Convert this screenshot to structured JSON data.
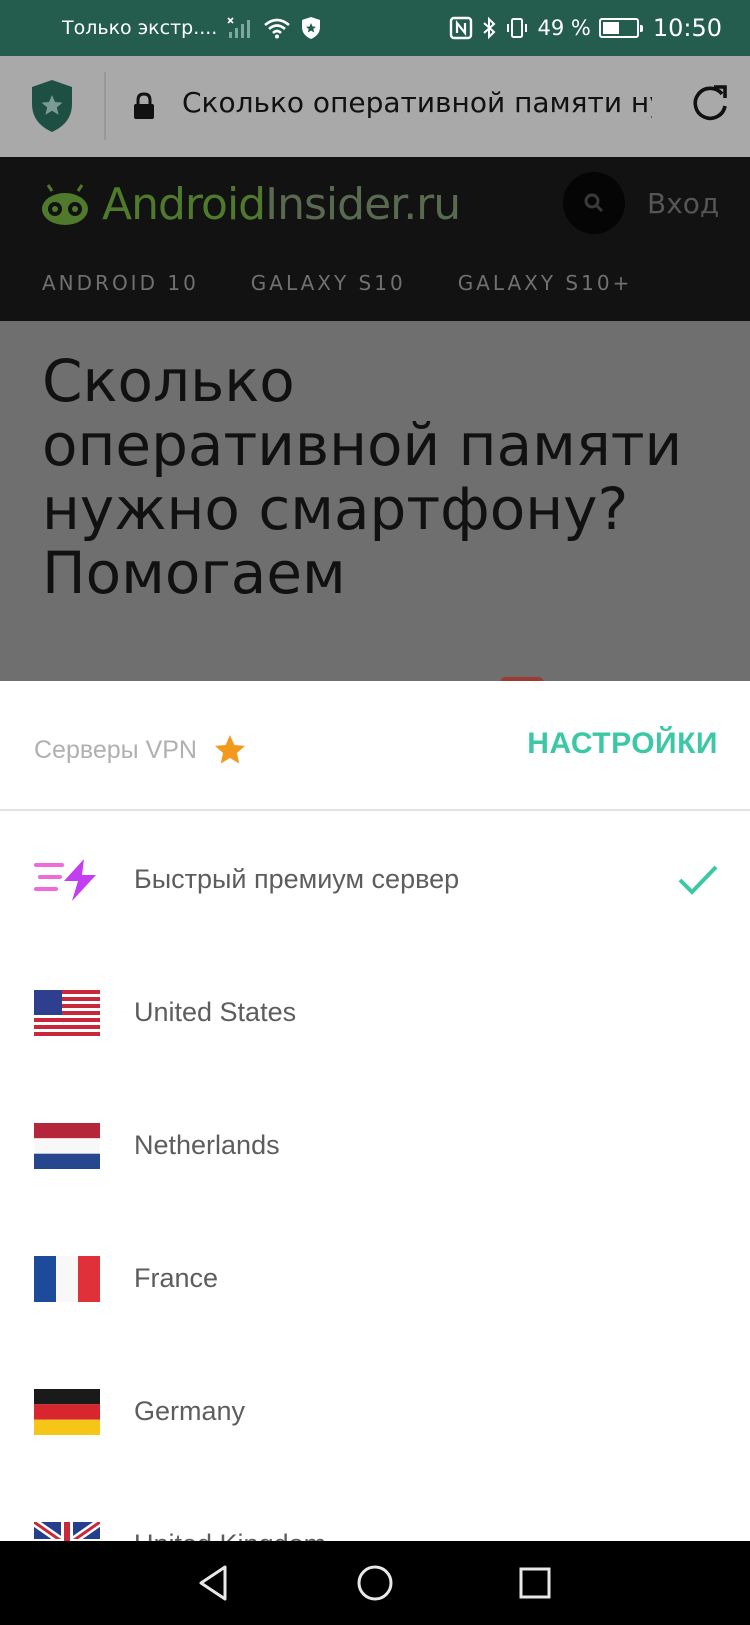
{
  "status_bar": {
    "carrier": "Только экстр....",
    "battery_percent": "49 %",
    "battery_level": 0.49,
    "time": "10:50"
  },
  "browser": {
    "url": "Сколько оперативной памяти нуж"
  },
  "site": {
    "logo_android": "Android",
    "logo_rest": "Insider.ru",
    "login": "Вход",
    "nav": [
      "ANDROID 10",
      "GALAXY S10",
      "GALAXY S10+"
    ]
  },
  "article": {
    "title": "Сколько оперативной памяти нужно смартфону? Помогаем"
  },
  "sheet": {
    "title": "Серверы VPN",
    "settings_label": "НАСТРОЙКИ",
    "servers": [
      {
        "label": "Быстрый премиум сервер",
        "icon": "lightning-icon",
        "selected": true
      },
      {
        "label": "United States",
        "icon": "us-flag-icon",
        "selected": false
      },
      {
        "label": "Netherlands",
        "icon": "nl-flag-icon",
        "selected": false
      },
      {
        "label": "France",
        "icon": "fr-flag-icon",
        "selected": false
      },
      {
        "label": "Germany",
        "icon": "de-flag-icon",
        "selected": false
      },
      {
        "label": "United Kingdom",
        "icon": "uk-flag-icon",
        "selected": false
      }
    ]
  },
  "colors": {
    "status_bar": "#245d4e",
    "accent": "#3cc8a4",
    "star": "#f39a1e",
    "lightning": "#c23ef0"
  }
}
